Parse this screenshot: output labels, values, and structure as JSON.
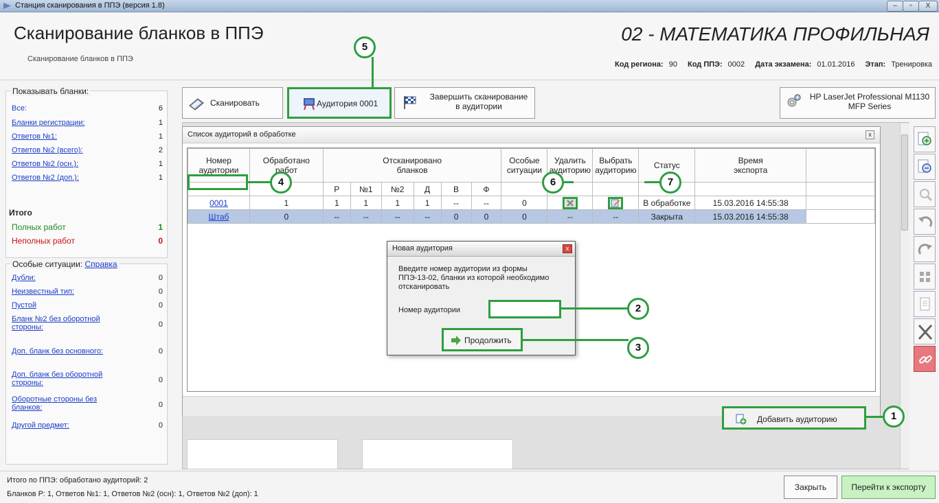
{
  "window": {
    "title": "Станция сканирования в ППЭ (версия 1.8)",
    "minimize_glyph": "–",
    "maximize_glyph": "▫",
    "close_glyph": "X"
  },
  "header": {
    "title": "Сканирование бланков в ППЭ",
    "subtitle": "Сканирование бланков в ППЭ",
    "exam": "02 - МАТЕМАТИКА ПРОФИЛЬНАЯ",
    "region_label": "Код региона:",
    "region_value": "90",
    "ppe_label": "Код ППЭ:",
    "ppe_value": "0002",
    "date_label": "Дата экзамена:",
    "date_value": "01.01.2016",
    "stage_label": "Этап:",
    "stage_value": "Тренировка"
  },
  "left_panel": {
    "show_title": "Показывать бланки:",
    "show_items": [
      {
        "label": "Все:",
        "count": "6"
      },
      {
        "label": "Бланки регистрации:",
        "count": "1"
      },
      {
        "label": "Ответов №1:",
        "count": "1"
      },
      {
        "label": "Ответов №2 (всего):",
        "count": "2"
      },
      {
        "label": "Ответов №2 (осн.):",
        "count": "1"
      },
      {
        "label": "Ответов №2 (доп.):",
        "count": "1"
      }
    ],
    "itogo_title": "Итого",
    "full_label": "Полных работ",
    "full_count": "1",
    "partial_label": "Неполных работ",
    "partial_count": "0",
    "special_title": "Особые ситуации:",
    "special_help": "Справка",
    "special_items": [
      {
        "label": "Дубли:",
        "count": "0"
      },
      {
        "label": "Неизвестный тип:",
        "count": "0"
      },
      {
        "label": "Пустой",
        "count": "0"
      },
      {
        "label1": "Бланк №2 без оборотной",
        "label2": "стороны:",
        "count": "0"
      },
      {
        "label": "Доп. бланк без основного:",
        "count": "0"
      },
      {
        "label1": "Доп. бланк без оборотной",
        "label2": "стороны:",
        "count": "0"
      },
      {
        "label1": "Оборотные стороны без",
        "label2": "бланков:",
        "count": "0"
      },
      {
        "label": "Другой предмет:",
        "count": "0"
      }
    ]
  },
  "toolbar": {
    "scan_label": "Сканировать",
    "auditorium_label": "Аудитория 0001",
    "finish_line1": "Завершить сканирование",
    "finish_line2": "в аудитории",
    "printer_line1": "HP LaserJet Professional M1130",
    "printer_line2": "MFP Series"
  },
  "panel": {
    "title": "Список аудиторий в обработке",
    "close_glyph": "x",
    "columns": {
      "num1": "Номер",
      "num2": "аудитории",
      "proc1": "Обработано",
      "proc2": "работ",
      "scanned1": "Отсканировано",
      "scanned2": "бланков",
      "special1": "Особые",
      "special2": "ситуации",
      "delete1": "Удалить",
      "delete2": "аудиторию",
      "select1": "Выбрать",
      "select2": "аудиторию",
      "status": "Статус",
      "time1": "Время",
      "time2": "экспорта"
    },
    "subcolumns": [
      "Р",
      "№1",
      "№2",
      "Д",
      "В",
      "Ф"
    ],
    "rows": [
      {
        "num": "0001",
        "processed": "1",
        "r": "1",
        "n1": "1",
        "n2": "1",
        "d": "1",
        "v": "--",
        "f": "--",
        "special": "0",
        "del": "",
        "sel": "",
        "status": "В обработке",
        "time": "15.03.2016 14:55:38"
      },
      {
        "num": "Штаб",
        "processed": "0",
        "r": "--",
        "n1": "--",
        "n2": "--",
        "d": "--",
        "v": "0",
        "f": "0",
        "special": "0",
        "del": "--",
        "sel": "--",
        "status": "Закрыта",
        "time": "15.03.2016 14:55:38"
      }
    ],
    "add_label": "Добавить аудиторию"
  },
  "dialog": {
    "title": "Новая аудитория",
    "close_glyph": "x",
    "msg1": "Введите номер аудитории из формы",
    "msg2": "ППЭ-13-02, бланки из которой необходимо",
    "msg3": "отсканировать",
    "field_label": "Номер аудитории",
    "field_value": "",
    "continue_label": "Продолжить"
  },
  "callouts": [
    "1",
    "2",
    "3",
    "4",
    "5",
    "6",
    "7"
  ],
  "status": {
    "line1": "Итого по ППЭ: обработано аудиторий: 2",
    "line2": "Бланков Р: 1, Ответов №1: 1, Ответов №2 (осн): 1, Ответов №2 (доп): 1",
    "close_label": "Закрыть",
    "export_label": "Перейти к экспорту"
  },
  "icons": {
    "right_tools": [
      "zoom-in-icon",
      "zoom-out-icon",
      "search-icon",
      "rotate-left-icon",
      "rotate-right-icon",
      "fit-icon",
      "page-icon",
      "delete-icon",
      "link-icon"
    ]
  },
  "colors": {
    "accent_green": "#2e9e3f",
    "link_blue": "#1a3cc8",
    "selected_row": "#b6c8e4",
    "full_green": "#1d8a1d",
    "partial_red": "#cc1111"
  }
}
